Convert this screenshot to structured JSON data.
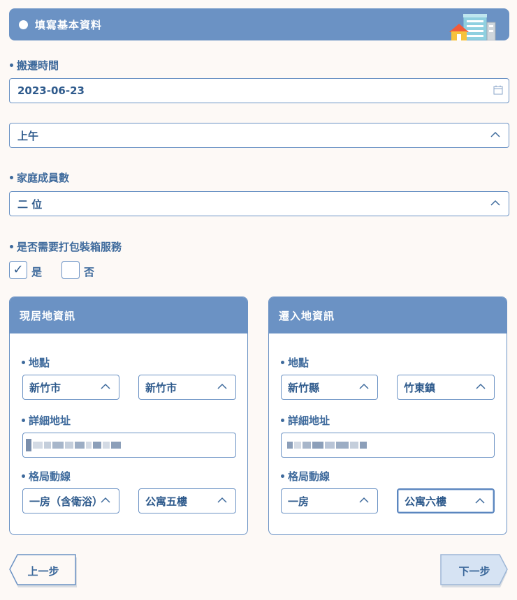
{
  "header": {
    "title": "填寫基本資料"
  },
  "moving_time": {
    "label": "搬遷時間",
    "date": "2023-06-23",
    "period": "上午"
  },
  "family": {
    "label": "家庭成員數",
    "value": "二 位"
  },
  "packing": {
    "label": "是否需要打包裝箱服務",
    "options": [
      {
        "label": "是",
        "checked": true
      },
      {
        "label": "否",
        "checked": false
      }
    ]
  },
  "current": {
    "title": "現居地資訊",
    "location_label": "地點",
    "city": "新竹市",
    "district": "新竹市",
    "address_label": "詳細地址",
    "layout_label": "格局動線",
    "room": "一房（含衛浴）",
    "building": "公寓五樓"
  },
  "destination": {
    "title": "遷入地資訊",
    "location_label": "地點",
    "city": "新竹縣",
    "district": "竹東鎮",
    "address_label": "詳細地址",
    "layout_label": "格局動線",
    "room": "一房",
    "building": "公寓六樓"
  },
  "nav": {
    "prev": "上一步",
    "next": "下一步"
  },
  "colors": {
    "accent": "#6b92c4",
    "text": "#3e6a9c",
    "background": "#fdf9f6"
  },
  "icons": [
    "building-icon",
    "calendar-icon",
    "chevron-up-icon",
    "check-icon"
  ]
}
